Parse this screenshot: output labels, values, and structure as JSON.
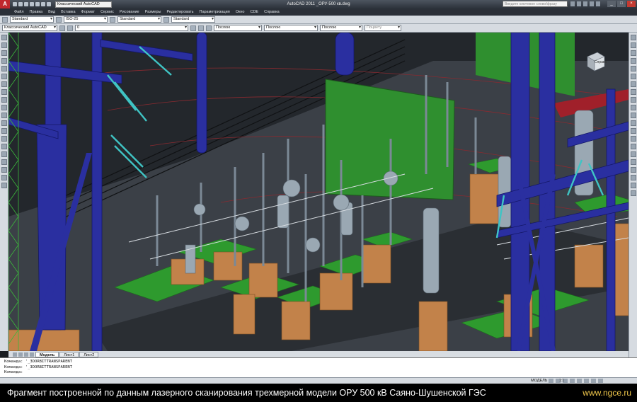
{
  "titlebar": {
    "app_logo": "A",
    "workspace": "Классический AutoCAD",
    "title": "AutoCAD 2011   _ОРУ-500 кв.dwg",
    "search_placeholder": "Введите ключевое слово/фразу",
    "minimize": "_",
    "maximize": "□",
    "close": "×"
  },
  "menu": {
    "items": [
      "Файл",
      "Правка",
      "Вид",
      "Вставка",
      "Формат",
      "Сервис",
      "Рисование",
      "Размеры",
      "Редактировать",
      "Параметризация",
      "Окно",
      "CDE",
      "Справка"
    ]
  },
  "toolbar_styles": {
    "text_style": "Standard",
    "dim_style": "ISO-25",
    "table_style": "Standard",
    "mleader_style": "Standard"
  },
  "toolbar_layers": {
    "workspace": "Классический AutoCAD",
    "layer_current": "0",
    "color": "Послою",
    "linetype": "Послою",
    "lineweight": "Послою",
    "plotstyle": "Поцвету"
  },
  "viewcube": {
    "label": "Справа"
  },
  "layout_tabs": {
    "tabs": [
      {
        "label": "Модель",
        "active": true
      },
      {
        "label": "Лист1",
        "active": false
      },
      {
        "label": "Лист2",
        "active": false
      }
    ]
  },
  "command_line": {
    "history": [
      "Команда: '_3DORBITTRANSPARENT",
      "Команда: '_3DORBITTRANSPARENT"
    ],
    "prompt": "Команда:"
  },
  "statusbar": {
    "mode": "МОДЕЛЬ",
    "scale": "1:1"
  },
  "caption": {
    "text": "Фрагмент построенной по данным лазерного сканирования трехмерной модели ОРУ 500 кВ Саяно-Шушенской ГЭС",
    "url": "www.ngce.ru"
  },
  "colors": {
    "steel_blue": "#2a2fa0",
    "equipment_gray": "#9aa8b3",
    "foundation_orange": "#c2824a",
    "platform_green": "#2e9a2e",
    "ground_dark": "#2c3036",
    "caption_url": "#f2c94c"
  }
}
